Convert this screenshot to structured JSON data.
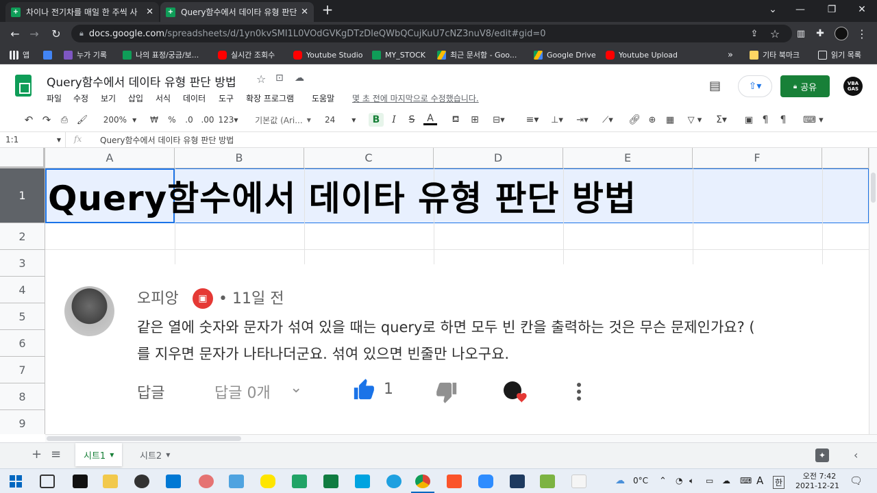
{
  "browser": {
    "tabs": [
      {
        "title": "차이나 전기차를 매일 한 주씩 사",
        "close": "✕"
      },
      {
        "title": "Query함수에서 데이타 유형 판단",
        "close": "✕"
      }
    ],
    "new_tab": "+",
    "url_host": "docs.google.com",
    "url_path": "/spreadsheets/d/1yn0kvSMI1L0VOdGVKgDTzDIeQWbQCujKuU7cNZ3nuV8/edit#gid=0",
    "bookmarks": [
      {
        "label": "앱",
        "color": "#e8eaed"
      },
      {
        "label": "",
        "color": "#4285f4"
      },
      {
        "label": "누가 기록",
        "color": "#7e57c2"
      },
      {
        "label": "나의 표정/궁금/보...",
        "color": "#0f9d58"
      },
      {
        "label": "실시간 조회수",
        "color": "#ff0000"
      },
      {
        "label": "Youtube Studio",
        "color": "#ff0000"
      },
      {
        "label": "MY_STOCK",
        "color": "#0f9d58"
      },
      {
        "label": "최근 문서함 - Goo...",
        "color": "#fbbc04"
      },
      {
        "label": "Google Drive",
        "color": "#fbbc04"
      },
      {
        "label": "Youtube Upload",
        "color": "#ff0000"
      }
    ],
    "bookmarks_more": "»",
    "bookmarks_other": "기타 북마크",
    "reading_list": "읽기 목록"
  },
  "sheets": {
    "doc_title": "Query함수에서 데이타 유형 판단 방법",
    "menus": [
      "파일",
      "수정",
      "보기",
      "삽입",
      "서식",
      "데이터",
      "도구",
      "확장 프로그램",
      "도움말"
    ],
    "last_edit": "몇 초 전에 마지막으로 수정했습니다.",
    "share_label": "공유",
    "avatar_text": "VBA GAS",
    "toolbar": {
      "zoom": "200%",
      "currency": "₩",
      "percent": "%",
      "dec_less": ".0",
      "dec_more": ".00",
      "format_more": "123",
      "font": "기본값 (Ari...",
      "size": "24",
      "bold": "B",
      "italic": "I",
      "strike": "S",
      "textcolor": "A"
    },
    "name_box": "1:1",
    "fx": "fx",
    "formula": "Query함수에서 데이타 유형 판단 방법",
    "columns": [
      "A",
      "B",
      "C",
      "D",
      "E",
      "F"
    ],
    "rows": [
      "1",
      "2",
      "3",
      "4",
      "5",
      "6",
      "7",
      "8",
      "9"
    ],
    "cell_a1": "Query함수에서 데이타 유형 판단 방법",
    "sheet_tabs": [
      "시트1",
      "시트2"
    ],
    "add_sheet": "+",
    "all_sheets": "≡"
  },
  "comment": {
    "author": "오피앙",
    "time": "• 11일 전",
    "line1": "같은 열에 숫자와 문자가 섞여 있을 때는 query로 하면 모두 빈 칸을 출력하는 것은 무슨 문제인가요? (",
    "line2": "를 지우면 문자가 나타나더군요. 섞여 있으면 빈줄만 나오구요.",
    "reply": "답글",
    "replies": "답글 0개",
    "chevron": "⌄",
    "like_count": "1"
  },
  "taskbar": {
    "temp": "0°C",
    "ime_a": "A",
    "ime_han": "한",
    "time": "오전 7:42",
    "date": "2021-12-21"
  }
}
